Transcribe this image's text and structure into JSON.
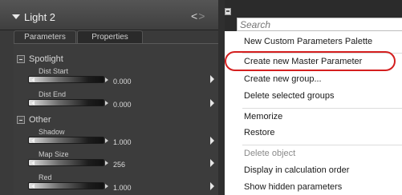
{
  "panel": {
    "title": "Light 2",
    "nav_prev": "<",
    "nav_next": ">",
    "tabs": [
      "Parameters",
      "Properties"
    ],
    "groups": [
      {
        "name": "Spotlight",
        "params": [
          {
            "label": "Dist Start",
            "value": "0.000"
          },
          {
            "label": "Dist End",
            "value": "0.000"
          }
        ]
      },
      {
        "name": "Other",
        "params": [
          {
            "label": "Shadow",
            "value": "1.000"
          },
          {
            "label": "Map Size",
            "value": "256"
          },
          {
            "label": "Red",
            "value": "1.000"
          }
        ]
      }
    ]
  },
  "menu": {
    "search_placeholder": "Search",
    "highlight_color": "#d41f1f",
    "items": [
      {
        "label": "New Custom Parameters Palette",
        "enabled": true
      },
      {
        "label": "Create new Master Parameter",
        "enabled": true,
        "highlighted": true
      },
      {
        "label": "Create new group...",
        "enabled": true
      },
      {
        "label": "Delete selected groups",
        "enabled": true
      },
      {
        "label": "Memorize",
        "enabled": true
      },
      {
        "label": "Restore",
        "enabled": true
      },
      {
        "label": "Delete object",
        "enabled": false
      },
      {
        "label": "Display in calculation order",
        "enabled": true
      },
      {
        "label": "Show hidden parameters",
        "enabled": true
      }
    ]
  }
}
